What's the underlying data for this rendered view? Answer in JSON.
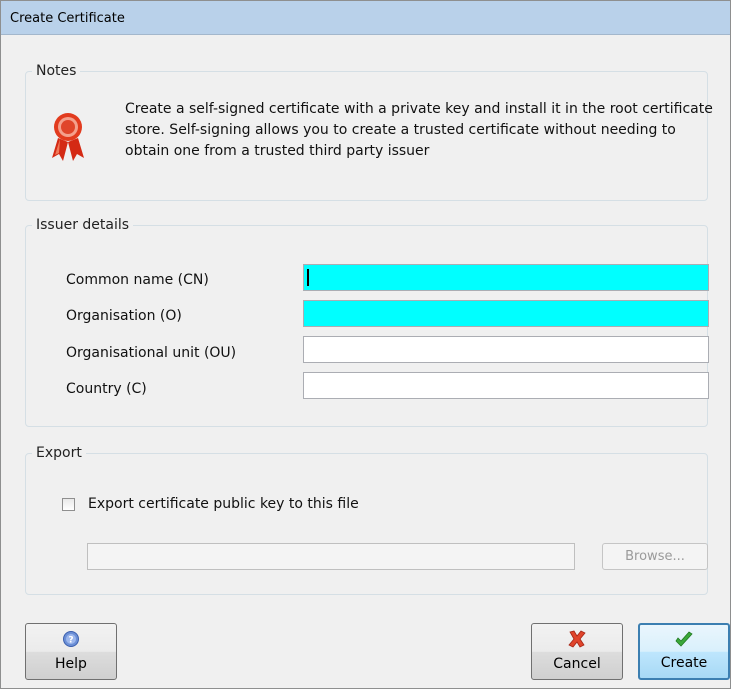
{
  "window": {
    "title": "Create Certificate"
  },
  "notes": {
    "legend": "Notes",
    "text": "Create a self-signed certificate with a private key and install it in the root certificate store. Self-signing allows you to create a trusted certificate without needing to obtain one from a trusted third party issuer"
  },
  "issuer": {
    "legend": "Issuer details",
    "fields": [
      {
        "label": "Common name (CN)",
        "value": "",
        "required": true
      },
      {
        "label": "Organisation (O)",
        "value": "",
        "required": true
      },
      {
        "label": "Organisational unit (OU)",
        "value": "",
        "required": false
      },
      {
        "label": "Country (C)",
        "value": "",
        "required": false
      }
    ]
  },
  "export": {
    "legend": "Export",
    "checkbox_label": "Export certificate public key to this file",
    "checked": false,
    "path_value": "",
    "browse_label": "Browse..."
  },
  "buttons": {
    "help": "Help",
    "cancel": "Cancel",
    "create": "Create"
  },
  "icons": {
    "notes": "certificate-ribbon-icon",
    "help": "help-icon",
    "cancel": "cancel-x-icon",
    "create": "checkmark-icon"
  },
  "colors": {
    "required_field": "#00ffff",
    "titlebar": "#b9d1ea"
  }
}
